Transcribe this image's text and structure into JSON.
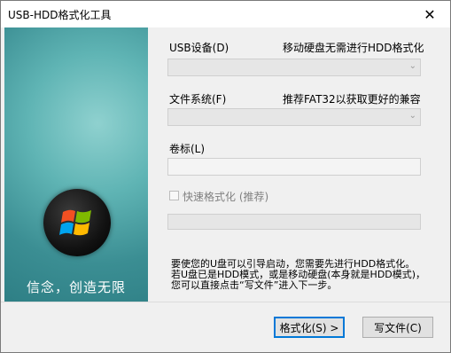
{
  "window": {
    "title": "USB-HDD格式化工具",
    "close_glyph": "✕"
  },
  "side_panel": {
    "tagline": "信念，创造无限"
  },
  "device": {
    "label": "USB设备(D)",
    "hint": "移动硬盘无需进行HDD格式化",
    "value": ""
  },
  "filesystem": {
    "label": "文件系统(F)",
    "hint": "推荐FAT32以获取更好的兼容",
    "value": ""
  },
  "volume": {
    "label": "卷标(L)",
    "value": ""
  },
  "quick_format": {
    "label": "快速格式化 (推荐)",
    "checked": false,
    "enabled": false
  },
  "progress": {
    "value": 0
  },
  "info_lines": [
    "要使您的U盘可以引导启动，您需要先进行HDD格式化。",
    "若U盘已是HDD模式，或是移动硬盘(本身就是HDD模式)，",
    "您可以直接点击“写文件”进入下一步。"
  ],
  "buttons": {
    "format": "格式化(S) >",
    "write": "写文件(C)"
  },
  "colors": {
    "panel_teal": "#3b8e93",
    "title_bg": "#ffffff",
    "dialog_bg": "#f0f0f0",
    "focus_border": "#0078d7"
  },
  "icons": {
    "close": "close-icon",
    "combo_arrow": "chevron-down-icon",
    "logo": "windows-logo-icon"
  }
}
